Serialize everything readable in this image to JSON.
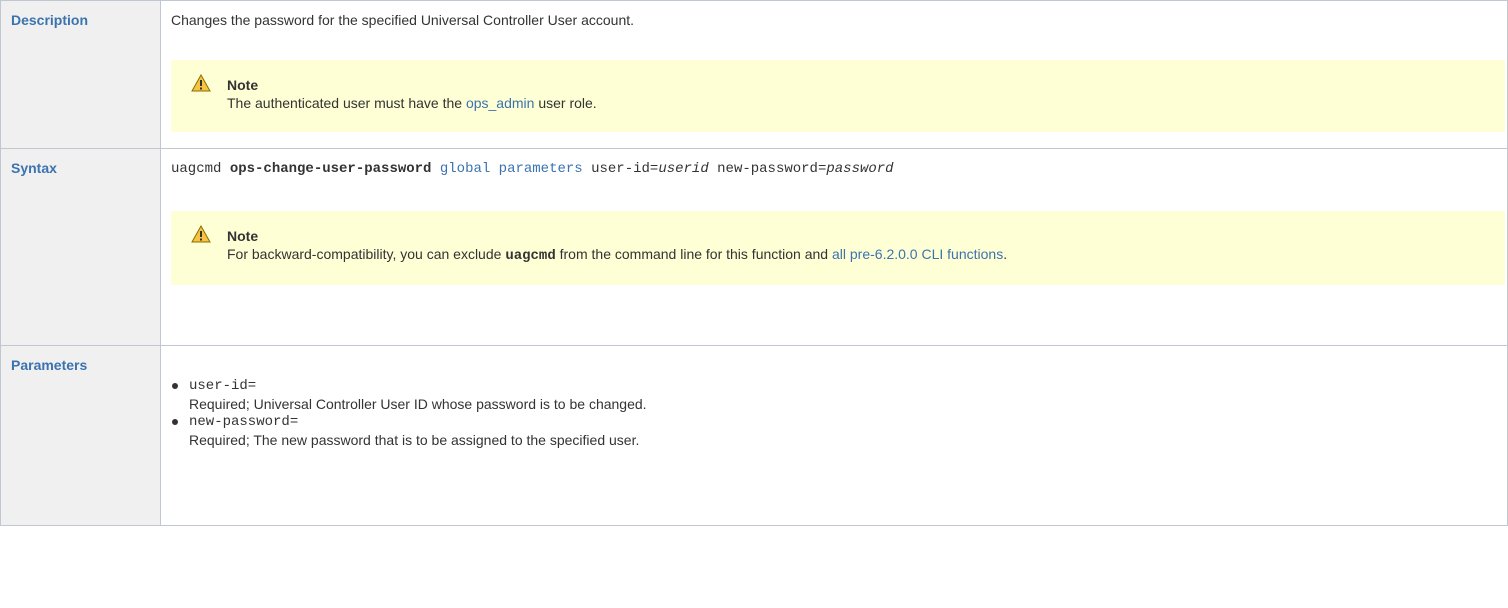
{
  "rows": {
    "description": {
      "label": "Description",
      "text": "Changes the password for the specified Universal Controller User account.",
      "note": {
        "title": "Note",
        "text_before": "The authenticated user must have the ",
        "link": "ops_admin",
        "text_after": " user role."
      }
    },
    "syntax": {
      "label": "Syntax",
      "cmd": "uagcmd ",
      "function": "ops-change-user-password",
      "space1": " ",
      "global_link": "global parameters",
      "user_id_key": " user-id=",
      "user_id_val": "userid",
      "new_password_key": " new-password=",
      "new_password_val": "password",
      "note": {
        "title": "Note",
        "text_before": "For backward-compatibility, you can exclude ",
        "code": "uagcmd",
        "text_middle": " from the command line for this function and ",
        "link": "all pre-6.2.0.0 CLI functions",
        "text_after": "."
      }
    },
    "parameters": {
      "label": "Parameters",
      "items": [
        {
          "name": "user-id=",
          "desc": "Required; Universal Controller User ID whose password is to be changed."
        },
        {
          "name": "new-password=",
          "desc": "Required; The new password that is to be assigned to the specified user."
        }
      ]
    }
  },
  "colors": {
    "link": "#3b73af",
    "header_bg": "#f0f0f0",
    "note_bg": "#ffffd6",
    "border": "#c1c7d0"
  },
  "icons": {
    "note": "warning-icon"
  }
}
